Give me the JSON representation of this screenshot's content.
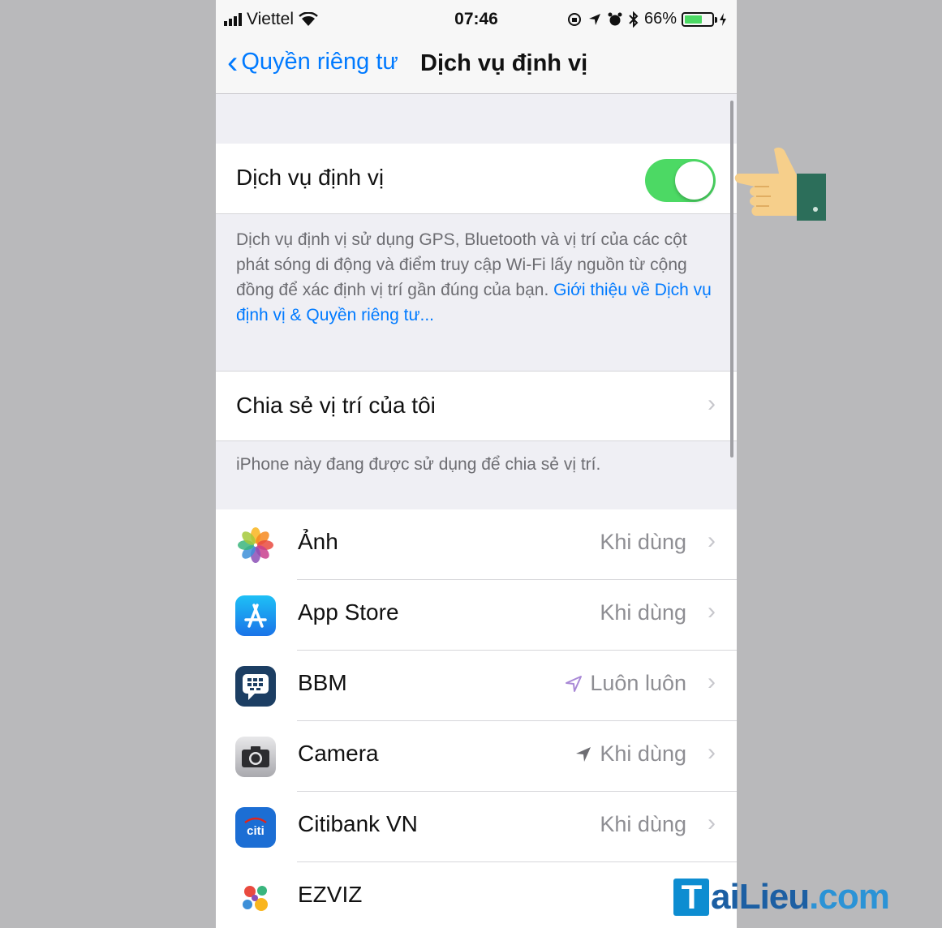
{
  "status_bar": {
    "carrier": "Viettel",
    "time": "07:46",
    "battery_percent": "66%",
    "battery_level": 0.66
  },
  "nav": {
    "back_label": "Quyền riêng tư",
    "title": "Dịch vụ định vị"
  },
  "location_services": {
    "label": "Dịch vụ định vị",
    "enabled": true,
    "description": "Dịch vụ định vị sử dụng GPS, Bluetooth và vị trí của các cột phát sóng di động và điểm truy cập Wi-Fi lấy nguồn từ cộng đồng để xác định vị trí gần đúng của bạn.",
    "link": "Giới thiệu về Dịch vụ định vị & Quyền riêng tư..."
  },
  "share_location": {
    "label": "Chia sẻ vị trí của tôi",
    "footer": "iPhone này đang được sử dụng để chia sẻ vị trí."
  },
  "apps": [
    {
      "name": "Ảnh",
      "value": "Khi dùng",
      "icon": "photos-icon",
      "arrow": ""
    },
    {
      "name": "App Store",
      "value": "Khi dùng",
      "icon": "app-store-icon",
      "arrow": ""
    },
    {
      "name": "BBM",
      "value": "Luôn luôn",
      "icon": "bbm-icon",
      "arrow": "outline"
    },
    {
      "name": "Camera",
      "value": "Khi dùng",
      "icon": "camera-icon",
      "arrow": "solid"
    },
    {
      "name": "Citibank VN",
      "value": "Khi dùng",
      "icon": "citibank-icon",
      "arrow": ""
    },
    {
      "name": "EZVIZ",
      "value": "",
      "icon": "ezviz-icon",
      "arrow": ""
    }
  ],
  "icons": {
    "citi_text": "citi"
  },
  "watermark": {
    "box_letter": "T",
    "part1": "ai",
    "part2": "Lieu",
    "part3": ".com"
  },
  "colors": {
    "ios_blue": "#007aff",
    "toggle_green": "#4cd964",
    "background": "#efeff4"
  }
}
